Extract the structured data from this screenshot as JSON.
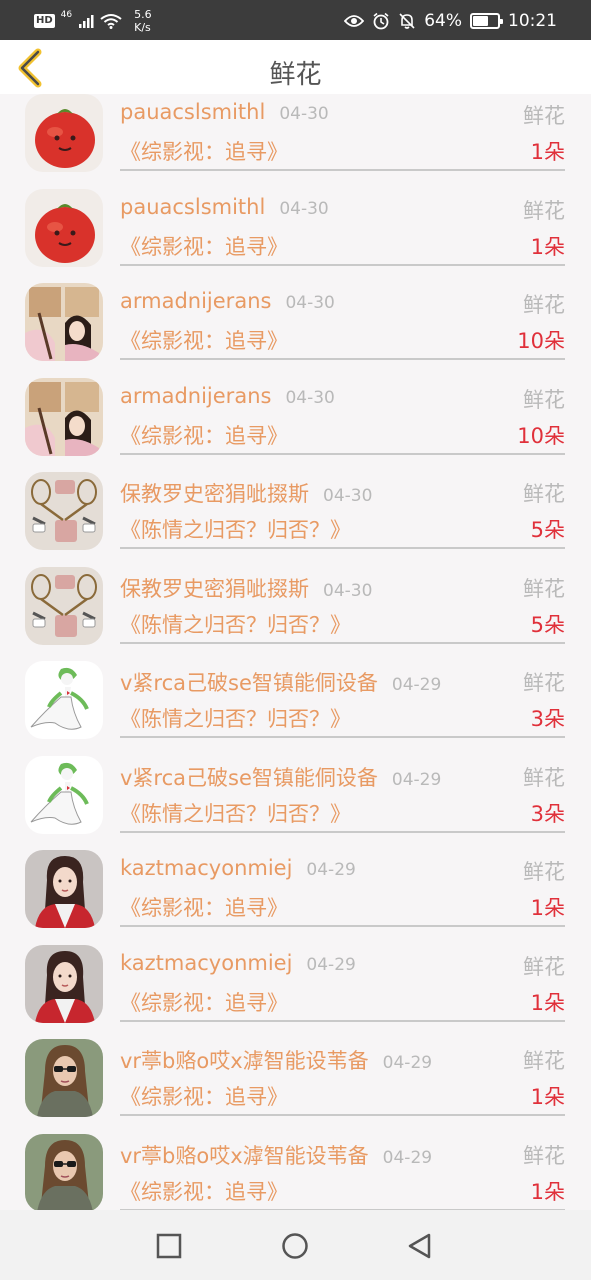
{
  "status_bar": {
    "hd": "HD",
    "network": "46",
    "speed_value": "5.6",
    "speed_unit": "K/s",
    "battery_percent": "64%",
    "battery_level": 0.64,
    "time": "10:21"
  },
  "header": {
    "title": "鲜花"
  },
  "items": [
    {
      "name": "pauacslsmithl",
      "date": "04-30",
      "type": "鲜花",
      "work": "《综影视：追寻》",
      "count": "1朵",
      "avatar": "tomato-avatar"
    },
    {
      "name": "pauacslsmithl",
      "date": "04-30",
      "type": "鲜花",
      "work": "《综影视：追寻》",
      "count": "1朵",
      "avatar": "tomato-avatar"
    },
    {
      "name": "armadnijerans",
      "date": "04-30",
      "type": "鲜花",
      "work": "《综影视：追寻》",
      "count": "10朵",
      "avatar": "girl-window-avatar"
    },
    {
      "name": "armadnijerans",
      "date": "04-30",
      "type": "鲜花",
      "work": "《综影视：追寻》",
      "count": "10朵",
      "avatar": "girl-window-avatar"
    },
    {
      "name": "保教罗史密狷呲掇斯",
      "date": "04-30",
      "type": "鲜花",
      "work": "《陈情之归否？归否？》",
      "count": "5朵",
      "avatar": "tennis-outfit-avatar"
    },
    {
      "name": "保教罗史密狷呲掇斯",
      "date": "04-30",
      "type": "鲜花",
      "work": "《陈情之归否？归否？》",
      "count": "5朵",
      "avatar": "tennis-outfit-avatar"
    },
    {
      "name": "v紧rca己破se智镇能侗设备",
      "date": "04-29",
      "type": "鲜花",
      "work": "《陈情之归否？归否？》",
      "count": "3朵",
      "avatar": "gardevoir-avatar"
    },
    {
      "name": "v紧rca己破se智镇能侗设备",
      "date": "04-29",
      "type": "鲜花",
      "work": "《陈情之归否？归否？》",
      "count": "3朵",
      "avatar": "gardevoir-avatar"
    },
    {
      "name": "kaztmacyonmiej",
      "date": "04-29",
      "type": "鲜花",
      "work": "《综影视：追寻》",
      "count": "1朵",
      "avatar": "woman-red-coat-avatar"
    },
    {
      "name": "kaztmacyonmiej",
      "date": "04-29",
      "type": "鲜花",
      "work": "《综影视：追寻》",
      "count": "1朵",
      "avatar": "woman-red-coat-avatar"
    },
    {
      "name": "vr葶b赂o哎x滹智能设苇备",
      "date": "04-29",
      "type": "鲜花",
      "work": "《综影视：追寻》",
      "count": "1朵",
      "avatar": "woman-sunglasses-avatar"
    },
    {
      "name": "vr葶b赂o哎x滹智能设苇备",
      "date": "04-29",
      "type": "鲜花",
      "work": "《综影视：追寻》",
      "count": "1朵",
      "avatar": "woman-sunglasses-avatar"
    }
  ],
  "bottom_nav": {
    "buttons": [
      "recent-apps",
      "home",
      "back"
    ]
  },
  "colors": {
    "accent_orange": "#e89a63",
    "count_red": "#e0303a",
    "muted_gray": "#b9b9b9",
    "back_arrow_yellow": "#f2c230"
  }
}
